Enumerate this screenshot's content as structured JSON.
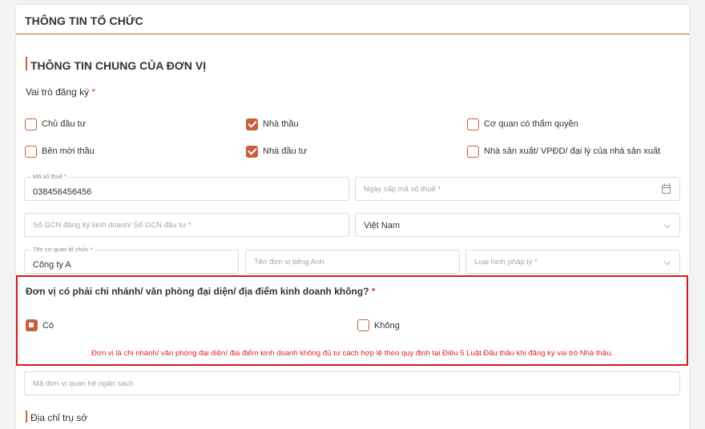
{
  "card": {
    "title": "THÔNG TIN TỔ CHỨC"
  },
  "section": {
    "title": "THÔNG TIN CHUNG CỦA ĐƠN VỊ"
  },
  "roles": {
    "label": "Vai trò đăng ký",
    "required_mark": "*",
    "options": [
      {
        "label": "Chủ đầu tư",
        "checked": false
      },
      {
        "label": "Nhà thầu",
        "checked": true
      },
      {
        "label": "Cơ quan có thẩm quyền",
        "checked": false
      },
      {
        "label": "Bên mời thầu",
        "checked": false
      },
      {
        "label": "Nhà đầu tư",
        "checked": true
      },
      {
        "label": "Nhà sản xuất/ VPĐD/ đại lý của nhà sản xuất",
        "checked": false
      }
    ]
  },
  "fields": {
    "tax_code": {
      "label": "Mã số thuế *",
      "value": "038456456456"
    },
    "tax_date": {
      "placeholder": "Ngày cấp mã số thuế *",
      "icon": "calendar-icon"
    },
    "business_cert": {
      "placeholder": "Số GCN đăng ký kinh doanh/ Số GCN đầu tư *"
    },
    "country": {
      "value": "Việt Nam"
    },
    "org_name": {
      "label": "Tên cơ quan tổ chức *",
      "value": "Công ty A"
    },
    "english_name": {
      "placeholder": "Tên đơn vị tiếng Anh"
    },
    "legal_type": {
      "placeholder": "Loại hình pháp lý *"
    },
    "budget_code": {
      "placeholder": "Mã đơn vị quan hệ ngân sách"
    }
  },
  "branch": {
    "question": "Đơn vị có phải chi nhánh/ văn phòng đại diện/ địa điểm kinh doanh không?",
    "required_mark": "*",
    "yes_label": "Có",
    "no_label": "Không",
    "selected": "yes",
    "error": "Đơn vị là chi nhánh/ văn phòng đại diện/ địa điểm kinh doanh không đủ tư cách hợp lệ theo quy định tại Điều 5 Luật Đấu thầu khi đăng ký vai trò Nhà thầu."
  },
  "address": {
    "label": "Địa chỉ trụ sở"
  },
  "colors": {
    "accent": "#c8603c",
    "error": "#cc1d1d"
  }
}
